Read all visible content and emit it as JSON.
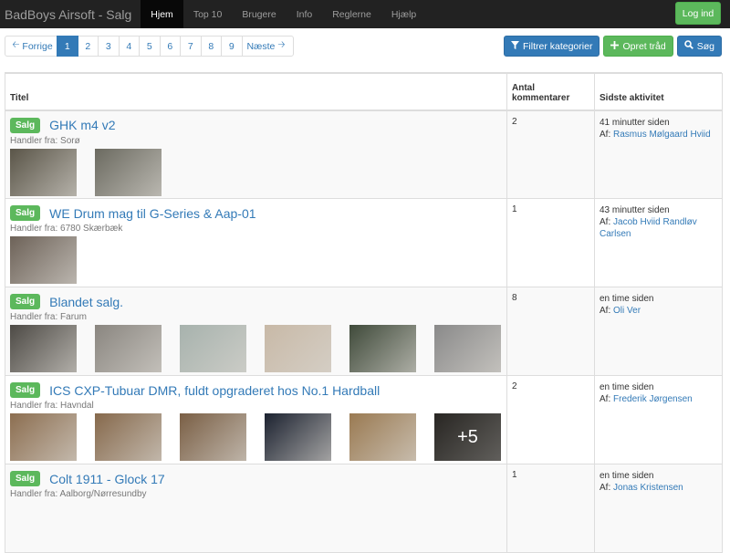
{
  "navbar": {
    "brand": "BadBoys Airsoft - Salg",
    "items": [
      {
        "label": "Hjem",
        "active": true
      },
      {
        "label": "Top 10"
      },
      {
        "label": "Brugere"
      },
      {
        "label": "Info"
      },
      {
        "label": "Reglerne"
      },
      {
        "label": "Hjælp"
      }
    ],
    "login_label": "Log ind"
  },
  "pagination": {
    "prev_label": "Forrige",
    "next_label": "Næste",
    "pages": [
      "1",
      "2",
      "3",
      "4",
      "5",
      "6",
      "7",
      "8",
      "9"
    ],
    "current_page": "1"
  },
  "actions": {
    "filter_label": "Filtrer kategorier",
    "create_label": "Opret tråd",
    "search_label": "Søg"
  },
  "table": {
    "headers": {
      "title": "Titel",
      "comments_line1": "Antal",
      "comments_line2": "kommentarer",
      "activity": "Sidste aktivitet"
    },
    "rows": [
      {
        "badge": "Salg",
        "title": "GHK m4 v2",
        "dealer": "Handler fra: Sorø",
        "comments": "2",
        "time": "41 minutter siden",
        "by_prefix": "Af:",
        "by": "Rasmus Mølgaard Hviid",
        "thumbs": [
          "#5a5548",
          "#6b6a60"
        ],
        "more": ""
      },
      {
        "badge": "Salg",
        "title": "WE Drum mag til G-Series & Aap-01",
        "dealer": "Handler fra: 6780 Skærbæk",
        "comments": "1",
        "time": "43 minutter siden",
        "by_prefix": "Af:",
        "by": "Jacob Hviid Randløv Carlsen",
        "thumbs": [
          "#6d6258"
        ],
        "more": ""
      },
      {
        "badge": "Salg",
        "title": "Blandet salg.",
        "dealer": "Handler fra: Farum",
        "comments": "8",
        "time": "en time siden",
        "by_prefix": "Af:",
        "by": "Oli Ver",
        "thumbs": [
          "#4d4a45",
          "#8a8680",
          "#a7b2ad",
          "#c8b9a7",
          "#3f4a3a",
          "#8a8a8a"
        ],
        "more": ""
      },
      {
        "badge": "Salg",
        "title": "ICS CXP-Tubuar DMR, fuldt opgraderet hos No.1 Hardball",
        "dealer": "Handler fra: Havndal",
        "comments": "2",
        "time": "en time siden",
        "by_prefix": "Af:",
        "by": "Frederik Jørgensen",
        "thumbs": [
          "#8c6e50",
          "#86694c",
          "#7a5f45",
          "#1c2230",
          "#9a7a52",
          "#4a4640"
        ],
        "more": "+5"
      },
      {
        "badge": "Salg",
        "title": "Colt 1911 - Glock 17",
        "dealer": "Handler fra: Aalborg/Nørresundby",
        "comments": "1",
        "time": "en time siden",
        "by_prefix": "Af:",
        "by": "Jonas Kristensen",
        "thumbs": [],
        "more": ""
      }
    ]
  }
}
